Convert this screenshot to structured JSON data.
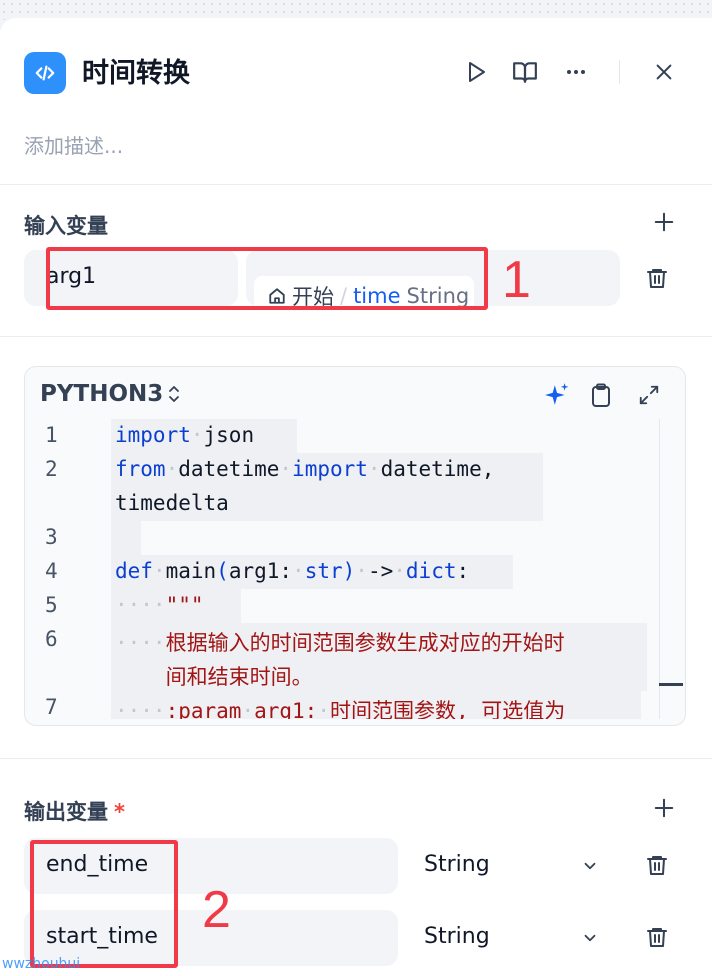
{
  "header": {
    "title": "时间转换",
    "description_placeholder": "添加描述..."
  },
  "input_section": {
    "label": "输入变量",
    "variables": [
      {
        "name": "arg1",
        "source_node": "开始",
        "source_sep": "/",
        "source_var": "time",
        "source_type": "String"
      }
    ]
  },
  "editor": {
    "language": "PYTHON3",
    "lines": [
      {
        "num": "1",
        "text": "import json"
      },
      {
        "num": "2",
        "text": "from datetime import datetime,"
      },
      {
        "num": "",
        "text": "timedelta"
      },
      {
        "num": "3",
        "text": ""
      },
      {
        "num": "4",
        "text": "def main(arg1: str) -> dict:"
      },
      {
        "num": "5",
        "text": "    \"\"\""
      },
      {
        "num": "6",
        "text": "    根据输入的时间范围参数生成对应的开始时"
      },
      {
        "num": "",
        "text": "    间和结束时间。"
      },
      {
        "num": "7",
        "text": "    :param arg1: 时间范围参数, 可选值为"
      }
    ]
  },
  "output_section": {
    "label": "输出变量",
    "required_mark": "*",
    "variables": [
      {
        "name": "end_time",
        "type": "String"
      },
      {
        "name": "start_time",
        "type": "String"
      }
    ]
  },
  "annotations": {
    "box1_number": "1",
    "box2_number": "2"
  },
  "watermark": "wwzhouhui",
  "colors": {
    "node_icon_bg": "#2e90fa",
    "annotation_red": "#f03a47",
    "keyword_blue": "#0b3fd1",
    "string_red": "#a31515"
  },
  "icons": [
    "code-icon",
    "play-icon",
    "book-icon",
    "more-icon",
    "close-icon",
    "plus-icon",
    "home-icon",
    "trash-icon",
    "sparkle-icon",
    "clipboard-icon",
    "expand-icon",
    "chevron-down-icon",
    "sort-icon"
  ]
}
